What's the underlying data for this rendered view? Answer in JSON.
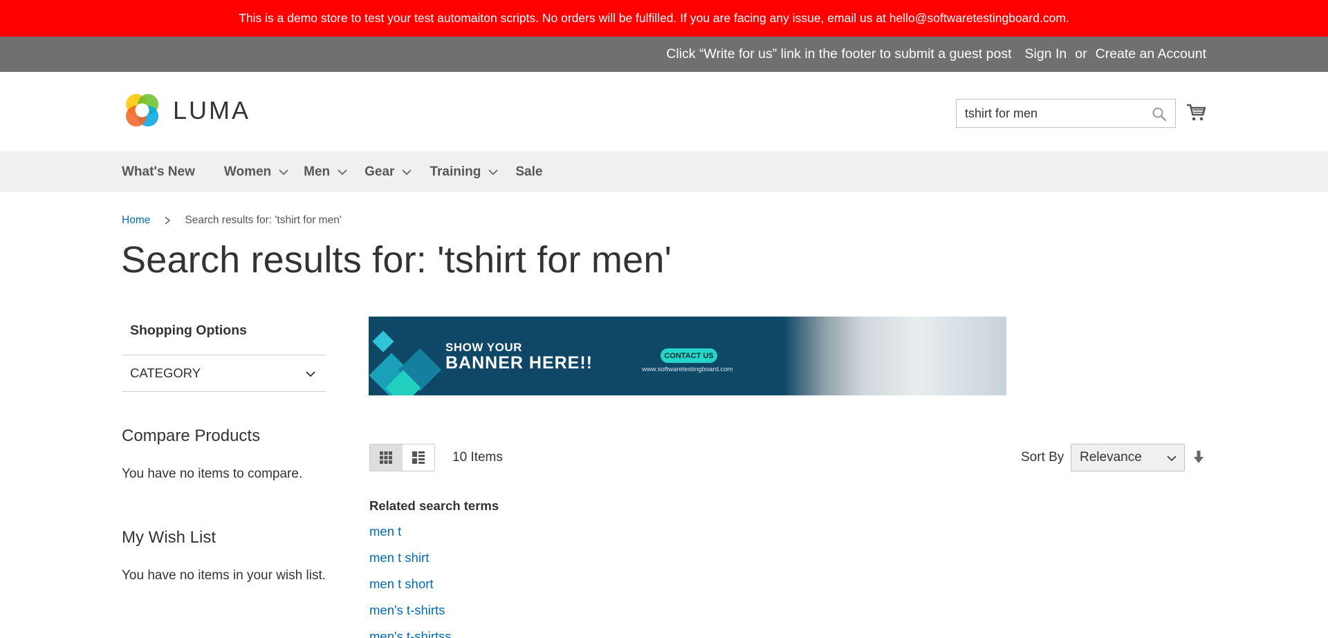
{
  "demo_notice": "This is a demo store to test your test automaiton scripts. No orders will be fulfilled. If you are facing any issue, email us at hello@softwaretestingboard.com.",
  "header": {
    "promo": "Click “Write for us” link in the footer to submit a guest post",
    "sign_in": "Sign In",
    "or": "or",
    "create_account": "Create an Account"
  },
  "logo_text": "LUMA",
  "search": {
    "value": "tshirt for men"
  },
  "nav": {
    "items": [
      {
        "label": "What's New",
        "has_dropdown": false
      },
      {
        "label": "Women",
        "has_dropdown": true
      },
      {
        "label": "Men",
        "has_dropdown": true
      },
      {
        "label": "Gear",
        "has_dropdown": true
      },
      {
        "label": "Training",
        "has_dropdown": true
      },
      {
        "label": "Sale",
        "has_dropdown": false
      }
    ]
  },
  "breadcrumb": {
    "home": "Home",
    "current": "Search results for: 'tshirt for men'"
  },
  "page_title": "Search results for: 'tshirt for men'",
  "sidebar": {
    "shopping_options": "Shopping Options",
    "category": "CATEGORY",
    "compare_title": "Compare Products",
    "compare_text": "You have no items to compare.",
    "wishlist_title": "My Wish List",
    "wishlist_text": "You have no items in your wish list."
  },
  "banner": {
    "line1": "SHOW YOUR",
    "line2": "BANNER HERE!!",
    "cta": "CONTACT US",
    "url": "www.softwaretestingboard.com"
  },
  "toolbar": {
    "items_count": "10 Items",
    "sort_label": "Sort By",
    "sort_value": "Relevance",
    "view_mode": "grid"
  },
  "related": {
    "title": "Related search terms",
    "terms": [
      "men t",
      "men t shirt",
      "men t short",
      "men's t-shirts",
      "men's t-shirtss"
    ]
  },
  "colors": {
    "demo_bar": "#ff0000",
    "panel_bar": "#6e716e",
    "link": "#006bb4",
    "nav_bg": "#f0f0f0"
  }
}
